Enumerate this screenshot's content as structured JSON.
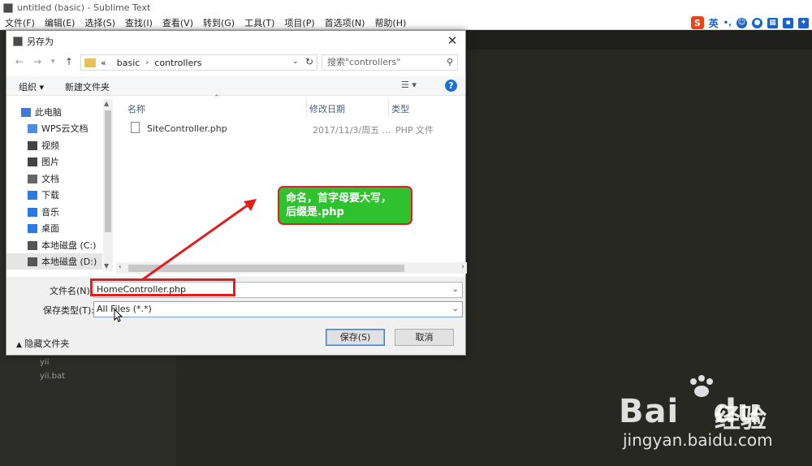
{
  "window": {
    "title": "untitled (basic) - Sublime Text"
  },
  "menu": [
    "文件(F)",
    "编辑(E)",
    "选择(S)",
    "查找(I)",
    "查看(V)",
    "转到(G)",
    "工具(T)",
    "项目(P)",
    "首选项(N)",
    "帮助(H)"
  ],
  "ime": {
    "logo": "S",
    "lang": "英",
    "punct": "•,"
  },
  "sidebar_files": [
    "yii",
    "yii.bat"
  ],
  "dialog": {
    "title": "另存为",
    "close": "✕",
    "path": {
      "prefix": "«",
      "parts": [
        "basic",
        "controllers"
      ]
    },
    "search_placeholder": "搜索\"controllers\"",
    "toolbar": {
      "organize": "组织 ▾",
      "new_folder": "新建文件夹",
      "view": "☰ ▾",
      "help": "?"
    },
    "nav_items": [
      {
        "label": "此电脑",
        "icon": "computer-icon",
        "color": "#3a7bd5"
      },
      {
        "label": "WPS云文档",
        "icon": "cloud-icon",
        "color": "#4a8ee8"
      },
      {
        "label": "视频",
        "icon": "video-icon",
        "color": "#444"
      },
      {
        "label": "图片",
        "icon": "picture-icon",
        "color": "#444"
      },
      {
        "label": "文档",
        "icon": "document-icon",
        "color": "#666"
      },
      {
        "label": "下载",
        "icon": "download-icon",
        "color": "#2a7ae2"
      },
      {
        "label": "音乐",
        "icon": "music-icon",
        "color": "#2a7ae2"
      },
      {
        "label": "桌面",
        "icon": "desktop-icon",
        "color": "#2a7ae2"
      },
      {
        "label": "本地磁盘 (C:)",
        "icon": "drive-icon",
        "color": "#555"
      },
      {
        "label": "本地磁盘 (D:)",
        "icon": "drive-icon",
        "color": "#555"
      }
    ],
    "columns": {
      "name": "名称",
      "modified": "修改日期",
      "type": "类型"
    },
    "files": [
      {
        "name": "SiteController.php",
        "modified": "2017/11/3/周五 ...",
        "type": "PHP 文件"
      }
    ],
    "filename_label": "文件名(N):",
    "filename_value": "HomeController.php",
    "filetype_label": "保存类型(T):",
    "filetype_value": "All Files (*.*)",
    "hide_folders": "隐藏文件夹",
    "save_button": "保存(S)",
    "cancel_button": "取消"
  },
  "annotation": {
    "text_line1": "命名，首字母要大写，",
    "text_line2": "后缀是.php"
  },
  "watermark": {
    "brand": "Bai",
    "brand_rest": "du",
    "jy": "经验",
    "url": "jingyan.baidu.com"
  }
}
